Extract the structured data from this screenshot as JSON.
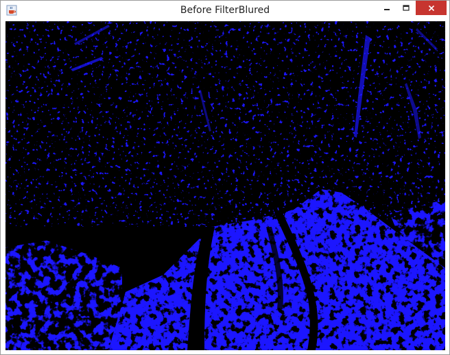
{
  "window": {
    "title": "Before FilterBlured",
    "app_icon": "java-coffee-cup-icon",
    "controls": [
      "minimize",
      "maximize",
      "close"
    ]
  },
  "canvas": {
    "description_color_fg": "#1410f0",
    "description_color_bg": "#000000"
  },
  "colors": {
    "titlebar_bg": "#ffffff",
    "close_button": "#c7352f",
    "image_background": "#000000",
    "image_foreground": "#1a14ff"
  }
}
